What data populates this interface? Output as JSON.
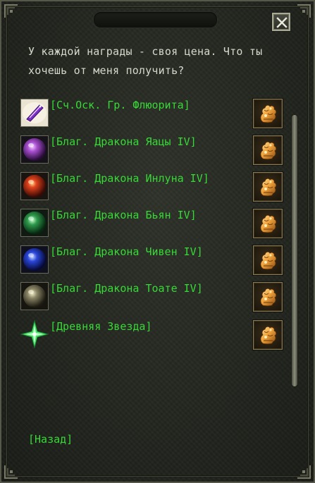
{
  "dialog": {
    "npc_text": "У каждой награды - своя цена. Что ты\nхочешь от меня получить?",
    "rewards": [
      {
        "label": "[Сч.Оск. Гр. Флюорита]",
        "icon": "fluorite-crystal-icon"
      },
      {
        "label": "[Благ. Дракона Яацы IV]",
        "icon": "purple-dragon-orb-icon"
      },
      {
        "label": "[Благ. Дракона Инлуна IV]",
        "icon": "red-dragon-orb-icon"
      },
      {
        "label": "[Благ. Дракона Бьян IV]",
        "icon": "green-dragon-orb-icon"
      },
      {
        "label": "[Благ. Дракона Чивен IV]",
        "icon": "blue-dragon-orb-icon"
      },
      {
        "label": "[Благ. Дракона Тоате IV]",
        "icon": "grey-dragon-orb-icon"
      },
      {
        "label": "[Древняя Звезда]",
        "icon": "ancient-star-icon"
      }
    ],
    "select_icon": "golden-statue-icon",
    "back_label": "[Назад]",
    "close_icon": "close-x-icon"
  },
  "colors": {
    "link_green": "#37d937",
    "text_light": "#d6d8cc",
    "panel_bg": "#262922"
  }
}
